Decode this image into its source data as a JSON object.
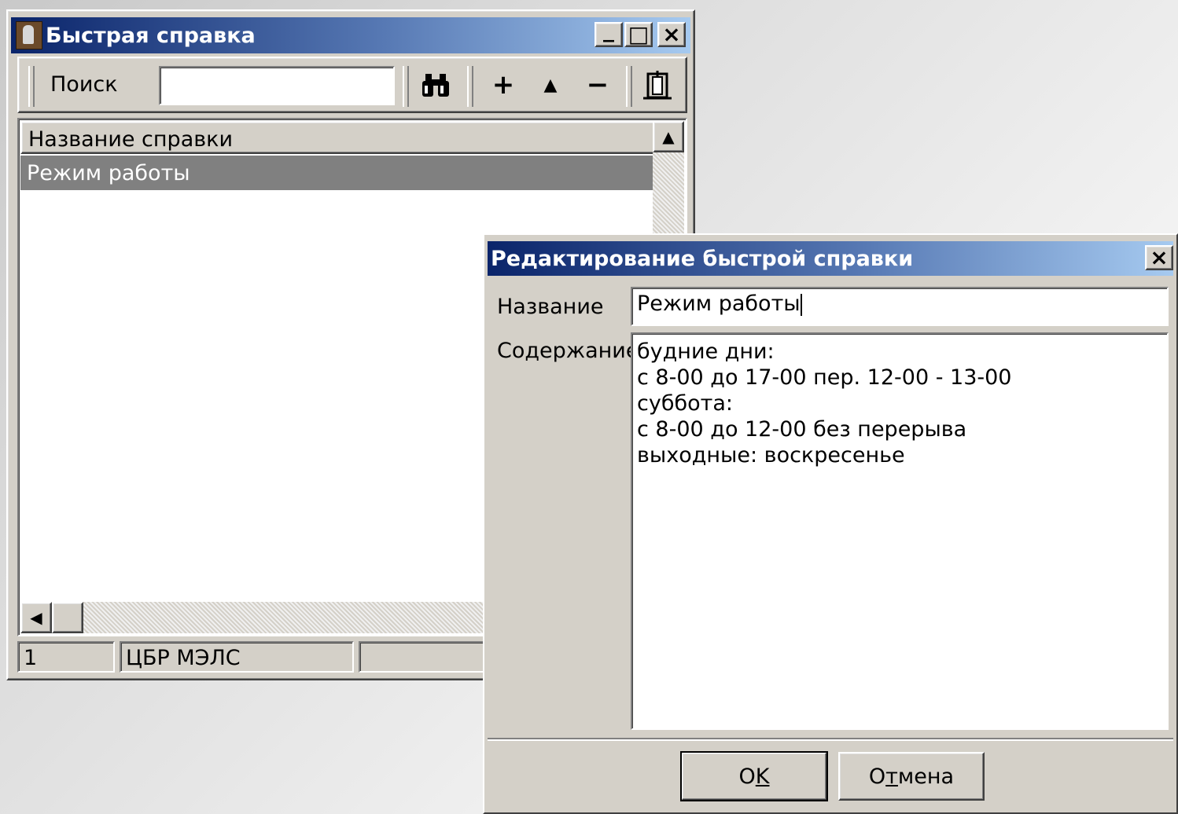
{
  "main_window": {
    "title": "Быстрая справка",
    "controls": {
      "minimize": "_",
      "maximize": "□",
      "close": "×"
    },
    "toolbar": {
      "search_label": "Поиск",
      "search_value": "",
      "find_icon": "binoculars-icon",
      "add_symbol": "+",
      "up_symbol": "▲",
      "remove_symbol": "−",
      "exit_icon": "exit-door-icon"
    },
    "list": {
      "column_header": "Название справки",
      "rows": [
        "Режим работы"
      ]
    },
    "statusbar": [
      "1",
      "ЦБР МЭЛС",
      ""
    ]
  },
  "dialog": {
    "title": "Редактирование быстрой справки",
    "close_symbol": "×",
    "name_label": "Название",
    "name_value": "Режим работы",
    "content_label": "Содержание",
    "content_lines": [
      "будние дни:",
      "с 8-00 до 17-00 пер. 12-00 - 13-00",
      "суббота:",
      "с 8-00 до 12-00 без перерыва",
      "выходные: воскресенье"
    ],
    "ok_button": {
      "pre": "O",
      "accel": "K",
      "post": ""
    },
    "cancel_button": {
      "pre": "О",
      "accel": "т",
      "post": "мена"
    }
  },
  "colors": {
    "title_active_start": "#0a246a",
    "title_active_end": "#a6caf0",
    "face": "#d4d0c8",
    "selection": "#808080"
  }
}
